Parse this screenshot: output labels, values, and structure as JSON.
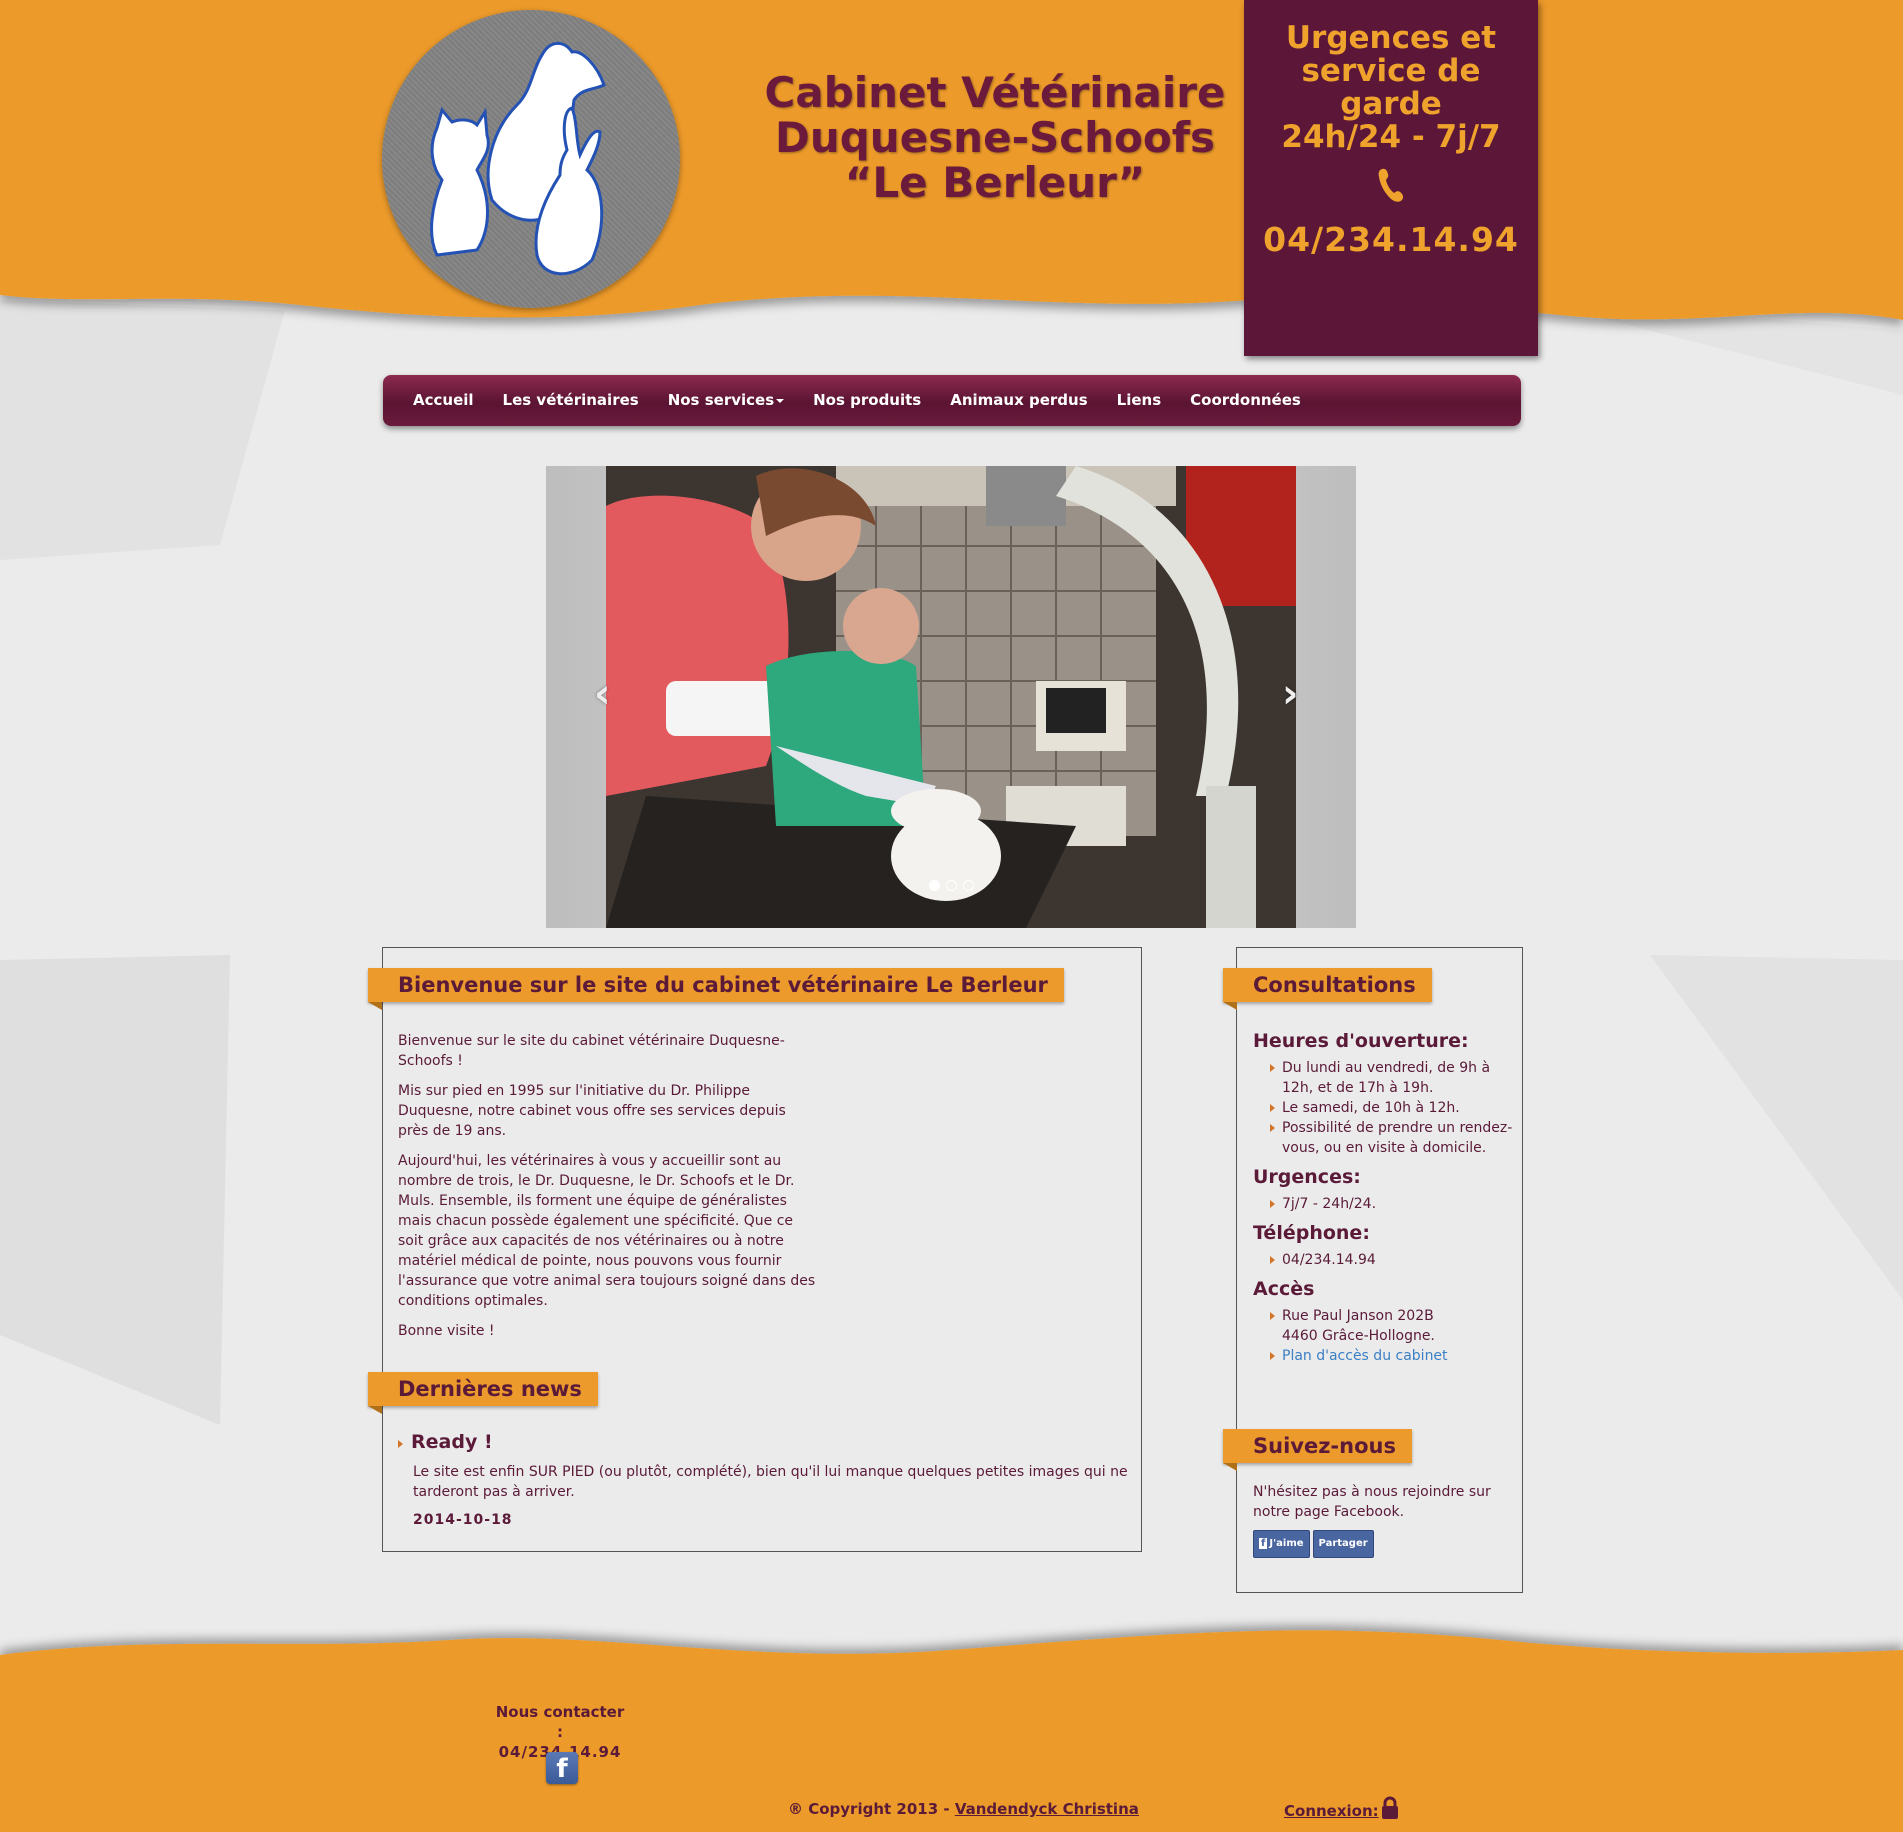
{
  "header": {
    "title_lines": [
      "Cabinet Vétérinaire",
      "Duquesne-Schoofs",
      "“Le Berleur”"
    ],
    "emergency": {
      "lines": [
        "Urgences et",
        "service de",
        "garde",
        "24h/24 - 7j/7"
      ],
      "phone_icon": "phone-icon",
      "number": "04/234.14.94"
    }
  },
  "nav": {
    "items": [
      {
        "label": "Accueil"
      },
      {
        "label": "Les vétérinaires"
      },
      {
        "label": "Nos services"
      },
      {
        "label": "Nos produits"
      },
      {
        "label": "Animaux perdus"
      },
      {
        "label": "Liens"
      },
      {
        "label": "Coordonnées"
      }
    ]
  },
  "carousel": {
    "prev": "‹",
    "next": "›",
    "active_slide": 1,
    "slide_count": 3
  },
  "welcome": {
    "heading": "Bienvenue sur le site du cabinet vétérinaire Le Berleur",
    "paragraphs": [
      "Bienvenue sur le site du cabinet vétérinaire Duquesne-Schoofs !",
      "Mis sur pied en 1995 sur l'initiative du Dr. Philippe Duquesne, notre cabinet vous offre ses services depuis près de 19 ans.",
      "Aujourd'hui, les vétérinaires à vous y accueillir sont au nombre de trois, le Dr. Duquesne, le Dr. Schoofs et le Dr. Muls. Ensemble, ils forment une équipe de généralistes mais chacun possède également une spécificité. Que ce soit grâce aux capacités de nos vétérinaires ou à notre matériel médical de pointe, nous pouvons vous fournir l'assurance que votre animal sera toujours soigné dans des conditions optimales.",
      "Bonne visite !"
    ]
  },
  "news": {
    "heading": "Dernières news",
    "item_title": "Ready !",
    "item_text": "Le site est enfin SUR PIED (ou plutôt, complété), bien qu'il lui manque quelques petites images qui ne tarderont pas à arriver.",
    "item_date": "2014-10-18"
  },
  "consultations": {
    "heading": "Consultations",
    "hours_title": "Heures d'ouverture:",
    "hours": [
      "Du lundi au vendredi, de 9h à 12h, et de 17h à 19h.",
      "Le samedi, de 10h à 12h.",
      "Possibilité de prendre un rendez-vous, ou en visite à domicile."
    ],
    "urgences_title": "Urgences:",
    "urgences": "7j/7 - 24h/24.",
    "phone_title": "Téléphone:",
    "phone": "04/234.14.94",
    "access_title": "Accès",
    "address": "Rue Paul Janson 202B 4460 Grâce-Hollogne.",
    "map_link": "Plan d'accès du cabinet"
  },
  "follow": {
    "heading": "Suivez-nous",
    "text": "N'hésitez pas à nous rejoindre sur notre page Facebook.",
    "like_label": "J'aime",
    "share_label": "Partager"
  },
  "footer": {
    "contact_label": "Nous contacter :",
    "contact_number": "04/234.14.94",
    "facebook_icon": "f",
    "copyright_prefix": "® Copyright 2013 - ",
    "copyright_author": "Vandendyck Christina",
    "login_label": "Connexion:",
    "lock_icon": "lock-icon"
  },
  "colors": {
    "orange": "#ec9a2b",
    "burgundy": "#5c1738",
    "text": "#5a1a38",
    "background": "#ebebeb"
  }
}
